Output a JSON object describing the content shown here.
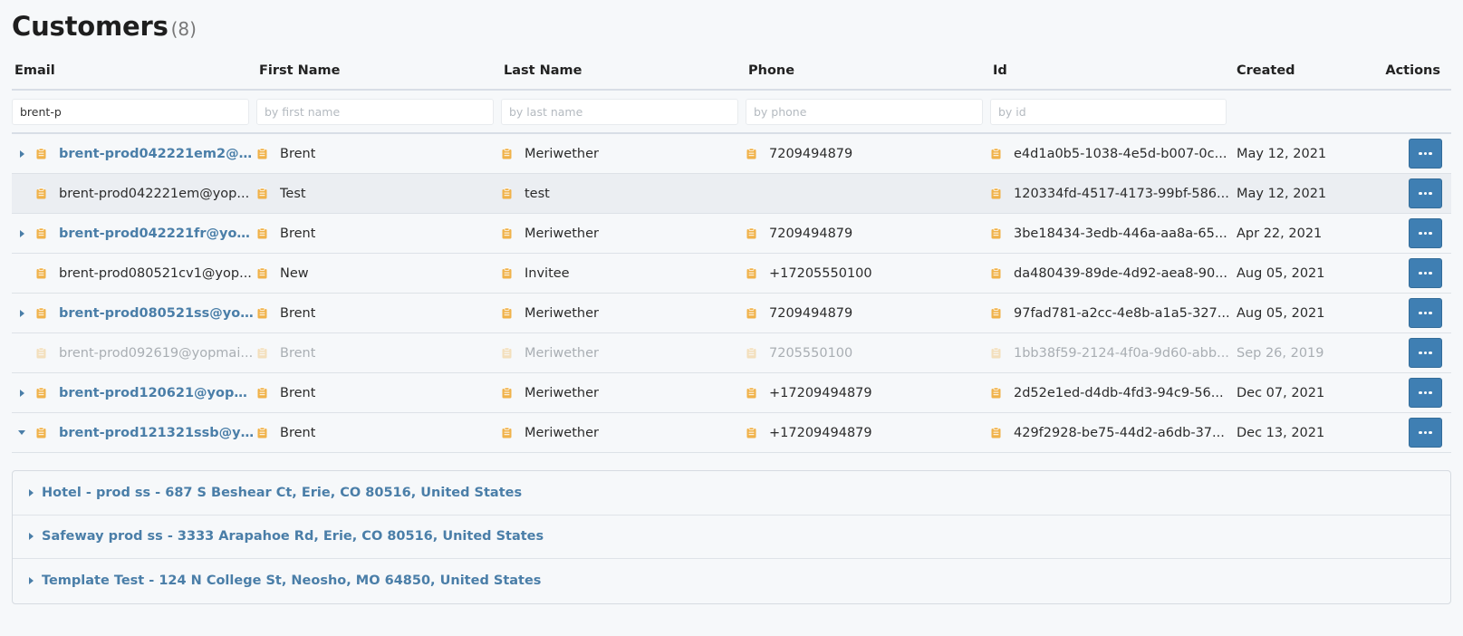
{
  "page": {
    "title": "Customers",
    "count": "(8)"
  },
  "colors": {
    "accent": "#4a7ea8",
    "action_button": "#3f7fb3",
    "clipboard_icon": "#f0b24a"
  },
  "columns": {
    "email": "Email",
    "first_name": "First Name",
    "last_name": "Last Name",
    "phone": "Phone",
    "id": "Id",
    "created": "Created",
    "actions": "Actions"
  },
  "filters": {
    "email": {
      "value": "brent-p",
      "placeholder": ""
    },
    "first_name": {
      "value": "",
      "placeholder": "by first name"
    },
    "last_name": {
      "value": "",
      "placeholder": "by last name"
    },
    "phone": {
      "value": "",
      "placeholder": "by phone"
    },
    "id": {
      "value": "",
      "placeholder": "by id"
    }
  },
  "rows": [
    {
      "email": "brent-prod042221em2@yo...",
      "first_name": "Brent",
      "last_name": "Meriwether",
      "phone": "7209494879",
      "id": "e4d1a0b5-1038-4e5d-b007-0c...",
      "created": "May 12, 2021",
      "expand": "collapsed",
      "linked": true,
      "faded": false
    },
    {
      "email": "brent-prod042221em@yop...",
      "first_name": "Test",
      "last_name": "test",
      "phone": "",
      "id": "120334fd-4517-4173-99bf-586...",
      "created": "May 12, 2021",
      "expand": "none",
      "linked": false,
      "faded": false
    },
    {
      "email": "brent-prod042221fr@yop...",
      "first_name": "Brent",
      "last_name": "Meriwether",
      "phone": "7209494879",
      "id": "3be18434-3edb-446a-aa8a-65...",
      "created": "Apr 22, 2021",
      "expand": "collapsed",
      "linked": true,
      "faded": false
    },
    {
      "email": "brent-prod080521cv1@yop...",
      "first_name": "New",
      "last_name": "Invitee",
      "phone": "+17205550100",
      "id": "da480439-89de-4d92-aea8-90...",
      "created": "Aug 05, 2021",
      "expand": "none",
      "linked": false,
      "faded": false
    },
    {
      "email": "brent-prod080521ss@yop...",
      "first_name": "Brent",
      "last_name": "Meriwether",
      "phone": "7209494879",
      "id": "97fad781-a2cc-4e8b-a1a5-327...",
      "created": "Aug 05, 2021",
      "expand": "collapsed",
      "linked": true,
      "faded": false
    },
    {
      "email": "brent-prod092619@yopmai...",
      "first_name": "Brent",
      "last_name": "Meriwether",
      "phone": "7205550100",
      "id": "1bb38f59-2124-4f0a-9d60-abb...",
      "created": "Sep 26, 2019",
      "expand": "none",
      "linked": false,
      "faded": true
    },
    {
      "email": "brent-prod120621@yopmai...",
      "first_name": "Brent",
      "last_name": "Meriwether",
      "phone": "+17209494879",
      "id": "2d52e1ed-d4db-4fd3-94c9-56...",
      "created": "Dec 07, 2021",
      "expand": "collapsed",
      "linked": true,
      "faded": false
    },
    {
      "email": "brent-prod121321ssb@yop...",
      "first_name": "Brent",
      "last_name": "Meriwether",
      "phone": "+17209494879",
      "id": "429f2928-be75-44d2-a6db-37...",
      "created": "Dec 13, 2021",
      "expand": "expanded",
      "linked": true,
      "faded": false
    }
  ],
  "addresses": [
    "Hotel - prod ss - 687 S Beshear Ct, Erie, CO 80516, United States",
    "Safeway prod ss - 3333 Arapahoe Rd, Erie, CO 80516, United States",
    "Template Test - 124 N College St, Neosho, MO 64850, United States"
  ]
}
